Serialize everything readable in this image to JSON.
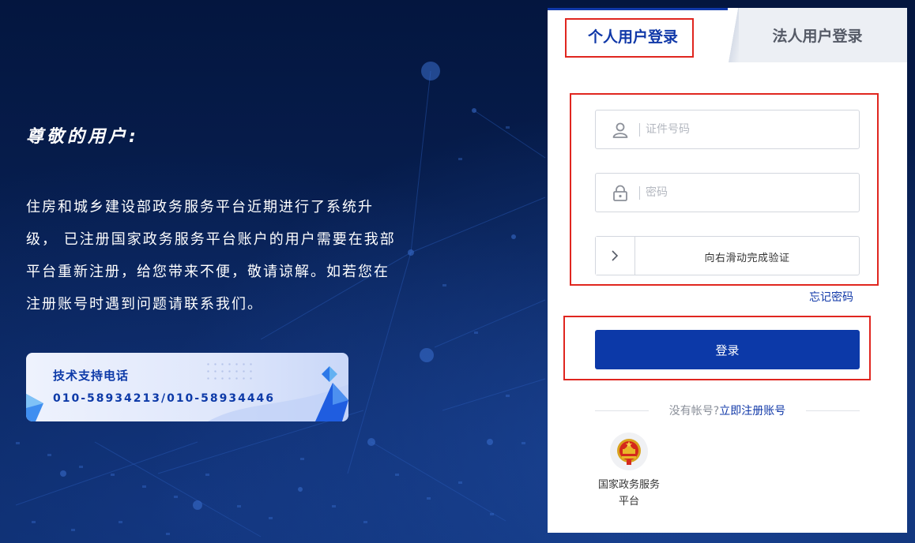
{
  "left": {
    "welcome_title": "尊敬的用户:",
    "notice_lines": [
      "住房和城乡建设部政务服务平台近期进行了系统升",
      "级， 已注册国家政务服务平台账户的用户需要在我部",
      "平台重新注册，给您带来不便，敬请谅解。如若您在",
      "注册账号时遇到问题请联系我们。"
    ],
    "support": {
      "title": "技术支持电话",
      "phone": "010-58934213/010-58934446"
    }
  },
  "panel": {
    "tabs": [
      {
        "label": "个人用户登录",
        "active": true
      },
      {
        "label": "法人用户登录",
        "active": false
      }
    ],
    "id_field": {
      "placeholder": "证件号码",
      "icon": "user-icon"
    },
    "password_field": {
      "placeholder": "密码",
      "icon": "lock-icon"
    },
    "slider": {
      "text": "向右滑动完成验证",
      "icon": "chevron-right-icon"
    },
    "forgot_password": "忘记密码",
    "login_button": "登录",
    "register": {
      "prompt": "没有帐号?",
      "link": "立即注册账号"
    },
    "gov_platform": {
      "label": "国家政务服务平台",
      "icon": "national-emblem-icon"
    }
  },
  "colors": {
    "accent": "#0c39a8",
    "highlight_border": "#e0261f",
    "background": "#061a4a"
  }
}
